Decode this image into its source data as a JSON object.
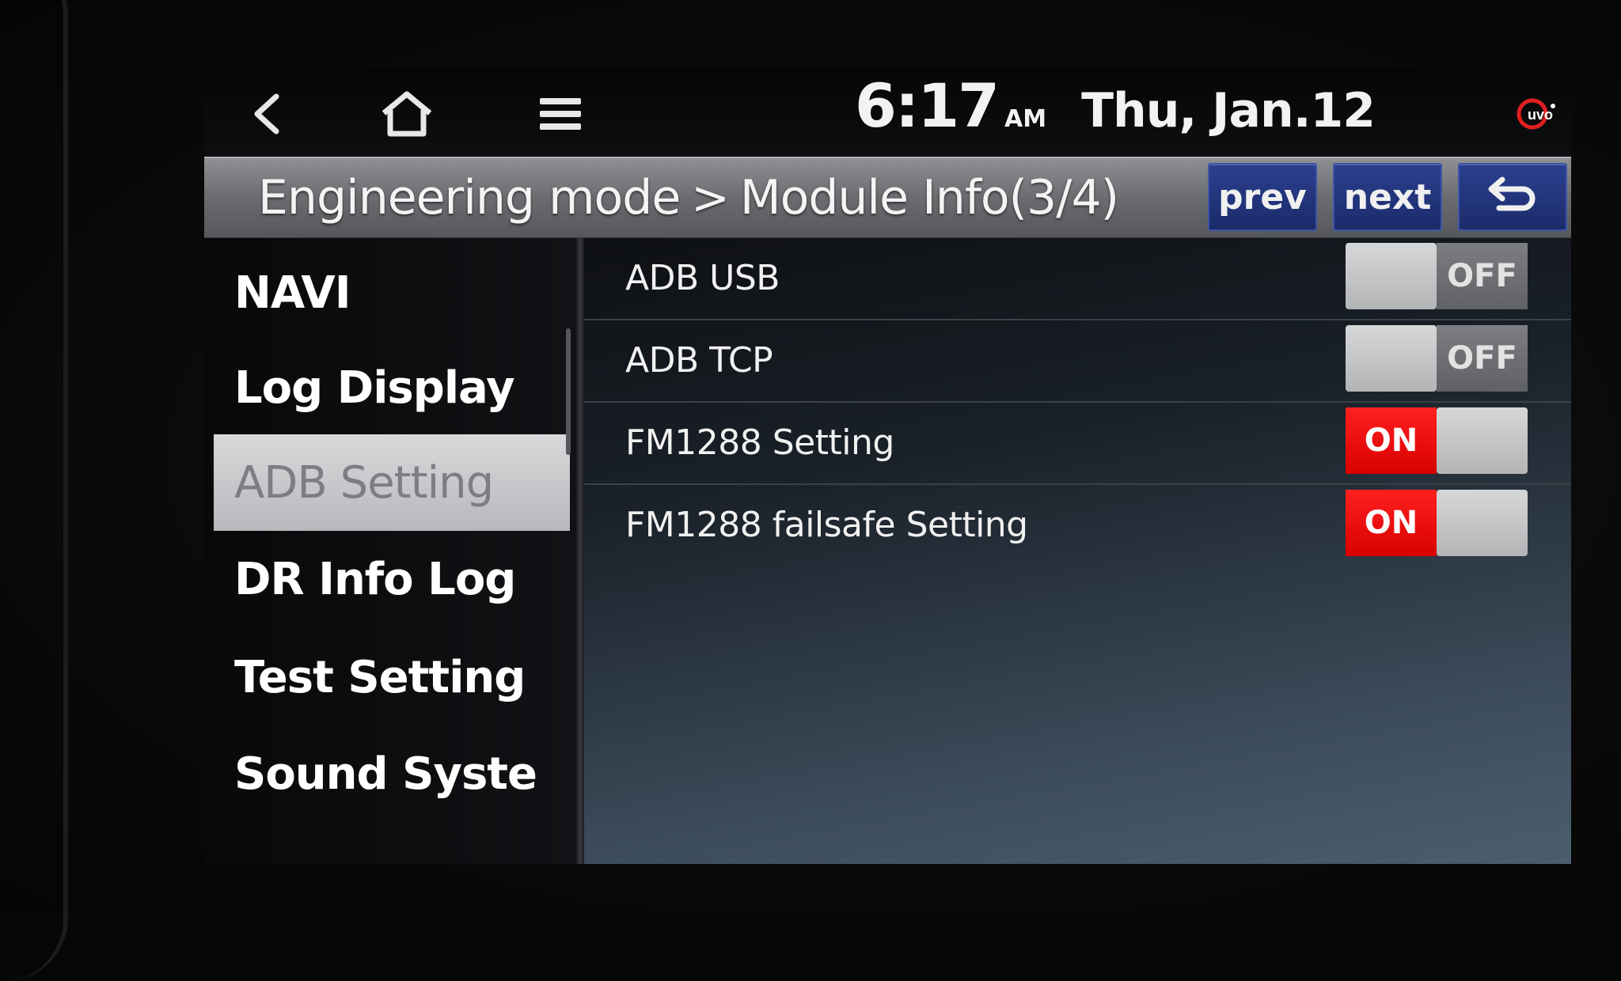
{
  "status_bar": {
    "back_icon": "chevron-left-icon",
    "home_icon": "home-icon",
    "menu_icon": "menu-icon",
    "time": "6:17",
    "ampm": "AM",
    "date": "Thu, Jan.12",
    "uvo_icon": "uvo-logo-icon"
  },
  "header": {
    "breadcrumb_parent": "Engineering mode",
    "breadcrumb_separator": ">",
    "breadcrumb_current": "Module Info(3/4)",
    "prev_label": "prev",
    "next_label": "next",
    "return_icon": "return-arrow-icon"
  },
  "sidebar": {
    "items": [
      {
        "label": "NAVI",
        "active": false
      },
      {
        "label": "Log Display",
        "active": false
      },
      {
        "label": "ADB Setting",
        "active": true
      },
      {
        "label": "DR Info Log",
        "active": false
      },
      {
        "label": "Test Setting",
        "active": false
      },
      {
        "label": "Sound Syste",
        "active": false
      }
    ]
  },
  "settings": {
    "rows": [
      {
        "label": "ADB USB",
        "state": "OFF"
      },
      {
        "label": "ADB TCP",
        "state": "OFF"
      },
      {
        "label": "FM1288 Setting",
        "state": "ON"
      },
      {
        "label": "FM1288 failsafe Setting",
        "state": "ON"
      }
    ]
  },
  "colors": {
    "on_red": "#e00000",
    "header_button_blue": "#22347a",
    "active_item_bg": "#c8c9cb"
  }
}
